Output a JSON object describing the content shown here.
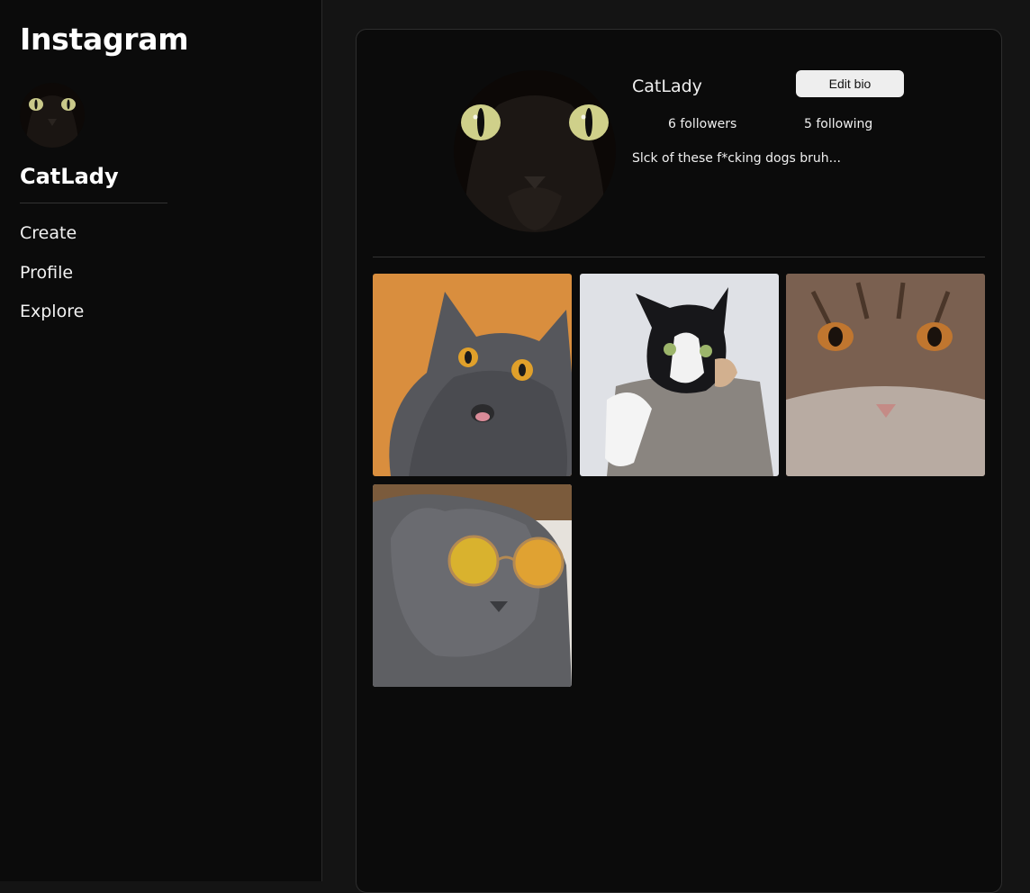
{
  "app": {
    "title": "Instagram"
  },
  "sidebar": {
    "username": "CatLady",
    "nav": [
      {
        "label": "Create"
      },
      {
        "label": "Profile"
      },
      {
        "label": "Explore"
      }
    ]
  },
  "profile": {
    "username": "CatLady",
    "edit_label": "Edit bio",
    "followers": "6 followers",
    "following": "5 following",
    "bio": "Slck of these f*cking dogs bruh..."
  },
  "posts": [
    {
      "subject": "grey cat with orange eyes on orange background"
    },
    {
      "subject": "black and white cat lying on grey couch"
    },
    {
      "subject": "tabby cat close-up"
    },
    {
      "subject": "grey fold cat wearing yellow sunglasses"
    }
  ],
  "colors": {
    "page_bg": "#141414",
    "panel_bg": "#0b0b0b",
    "button_bg": "#eeeeee",
    "text": "#ffffff"
  }
}
